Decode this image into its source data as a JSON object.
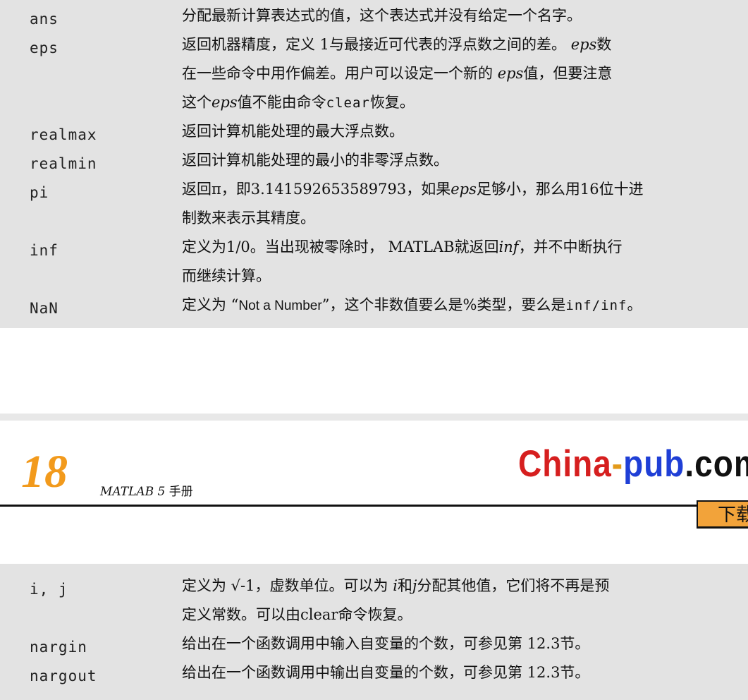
{
  "top_entries": [
    {
      "term": "ans",
      "lines": [
        [
          "分配最新计算表达式的值，这个表达式并没有给定一个名字。"
        ]
      ]
    },
    {
      "term": "eps",
      "lines": [
        [
          "返回机器精度，定义 1与最接近可代表的浮点数之间的差。 ",
          {
            "i": "eps"
          },
          "数"
        ],
        [
          "在一些命令中用作偏差。用户可以设定一个新的 ",
          {
            "i": "eps"
          },
          "值，但要注意"
        ],
        [
          "这个",
          {
            "i": "eps"
          },
          "值不能由命令",
          {
            "m": "clear"
          },
          "恢复。"
        ]
      ]
    },
    {
      "term": "realmax",
      "lines": [
        [
          "返回计算机能处理的最大浮点数。"
        ]
      ]
    },
    {
      "term": "realmin",
      "lines": [
        [
          "返回计算机能处理的最小的非零浮点数。"
        ]
      ]
    },
    {
      "term": "pi",
      "lines": [
        [
          "返回π，即3.141592653589793，如果",
          {
            "i": "eps"
          },
          "足够小，那么用16位十进"
        ],
        [
          "制数来表示其精度。"
        ]
      ]
    },
    {
      "term": "inf",
      "lines": [
        [
          "定义为1/0。当出现被零除时， MATLAB就返回",
          {
            "i": "inf"
          },
          "，并不中断执行"
        ],
        [
          "而继续计算。"
        ]
      ]
    },
    {
      "term": "NaN",
      "lines": [
        [
          "定义为 “",
          {
            "s": "Not a Number"
          },
          "”，这个非数值要么是%类型，要么是",
          {
            "m": "inf/inf"
          },
          "。"
        ]
      ]
    }
  ],
  "header": {
    "page_number": "18",
    "book_title_latin": "MATLAB 5",
    "book_title_cjk": "手册",
    "logo_parts": [
      {
        "text": "China",
        "color": "#d61f1f"
      },
      {
        "text": "-",
        "color": "#e39a1a"
      },
      {
        "text": "pub",
        "color": "#1f3fd6"
      },
      {
        "text": ".com",
        "color": "#111111"
      }
    ],
    "download_label": "下载"
  },
  "bottom_entries": [
    {
      "term": "i, j",
      "lines": [
        [
          "定义为 √-1，虚数单位。可以为 ",
          {
            "i": "i"
          },
          "和",
          {
            "i": "j"
          },
          "分配其他值，它们将不再是预"
        ],
        [
          "定义常数。可以由clear命令恢复。"
        ]
      ]
    },
    {
      "term": "nargin",
      "lines": [
        [
          "给出在一个函数调用中输入自变量的个数，可参见第 12.3节。"
        ]
      ]
    },
    {
      "term": "nargout",
      "lines": [
        [
          "给出在一个函数调用中输出自变量的个数，可参见第 12.3节。"
        ]
      ]
    }
  ]
}
